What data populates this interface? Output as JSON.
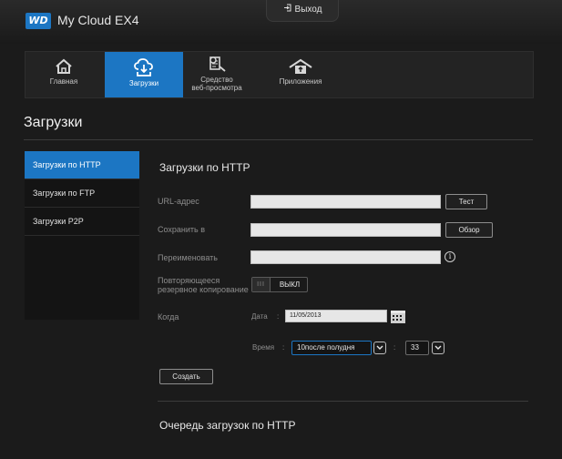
{
  "header": {
    "logo_text": "WD",
    "app_title": "My Cloud EX4",
    "logout_label": "Выход"
  },
  "nav": {
    "items": [
      {
        "label": "Главная",
        "icon": "home-icon"
      },
      {
        "label": "Загрузки",
        "icon": "download-cloud-icon",
        "active": true
      },
      {
        "label": "Средство веб-просмотра",
        "line1": "Средство",
        "line2": "веб-просмотра",
        "icon": "web-viewer-icon"
      },
      {
        "label": "Приложения",
        "icon": "apps-icon"
      }
    ]
  },
  "page": {
    "title": "Загрузки"
  },
  "sidebar": {
    "items": [
      {
        "label": "Загрузки по HTTP",
        "active": true
      },
      {
        "label": "Загрузки по FTP"
      },
      {
        "label": "Загрузки P2P"
      }
    ]
  },
  "form": {
    "section_title": "Загрузки по HTTP",
    "url_label": "URL-адрес",
    "url_value": "",
    "test_button": "Тест",
    "save_to_label": "Сохранить в",
    "save_to_value": "",
    "browse_button": "Обзор",
    "rename_label": "Переименовать",
    "rename_value": "",
    "info_glyph": "i",
    "backup_label_line1": "Повторяющееся",
    "backup_label_line2": "резервное копирование",
    "toggle_grip": "III",
    "toggle_state": "ВЫКЛ",
    "when_label": "Когда",
    "date_label": "Дата",
    "date_sep": ":",
    "date_value": "11/05/2013",
    "time_label": "Время",
    "time_sep": ":",
    "hour_value": "10после полудня",
    "minute_value": "33",
    "minute_sep": ":",
    "create_button": "Создать"
  },
  "queue": {
    "title": "Очередь загрузок по HTTP"
  },
  "colors": {
    "accent": "#1c76c3",
    "background": "#1b1b1b"
  }
}
